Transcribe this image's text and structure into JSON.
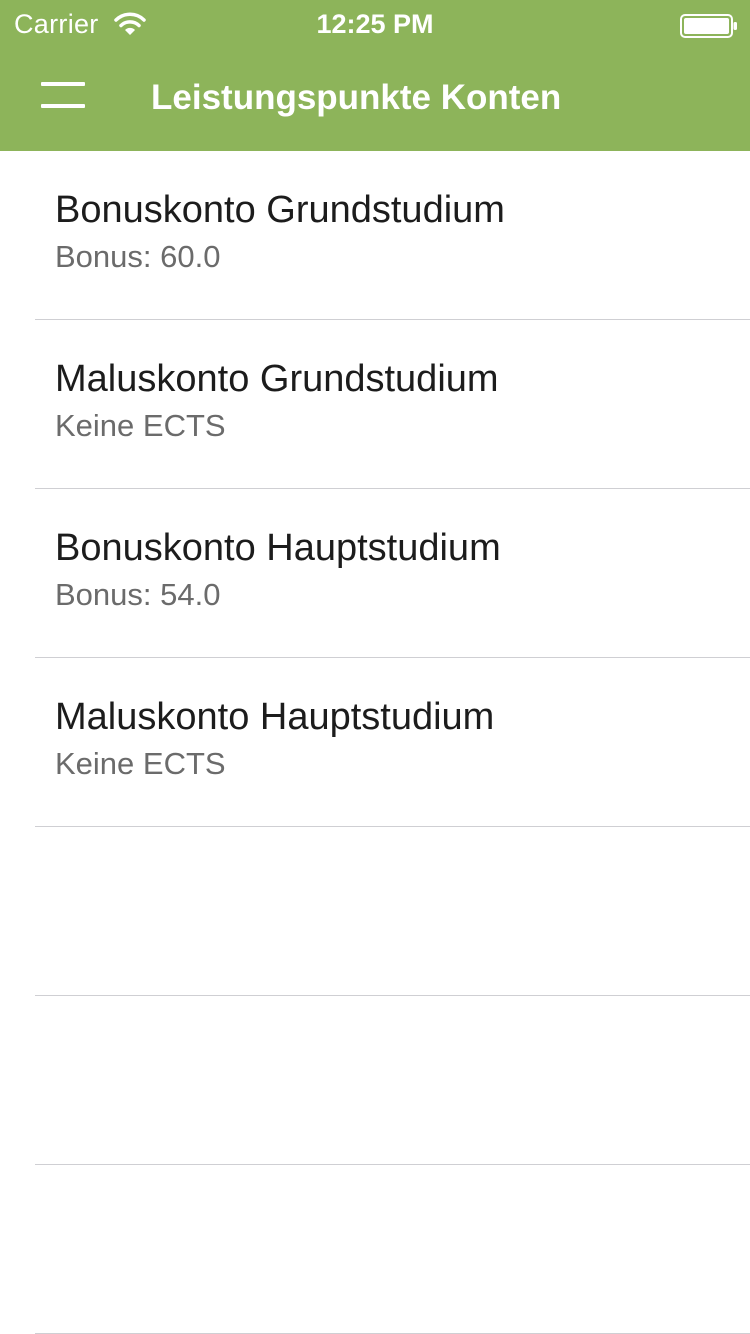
{
  "status_bar": {
    "carrier": "Carrier",
    "time": "12:25 PM",
    "wifi_icon": "wifi-icon",
    "battery_icon": "battery-icon"
  },
  "nav_bar": {
    "menu_icon": "hamburger-menu-icon",
    "title": "Leistungspunkte Konten"
  },
  "colors": {
    "header_background": "#8db45a",
    "header_text": "#ffffff",
    "title_text": "#1c1c1c",
    "subtitle_text": "#6b6b6b",
    "separator": "#cfcfd3"
  },
  "accounts": [
    {
      "title": "Bonuskonto Grundstudium",
      "subtitle": "Bonus: 60.0"
    },
    {
      "title": "Maluskonto Grundstudium",
      "subtitle": "Keine ECTS"
    },
    {
      "title": "Bonuskonto Hauptstudium",
      "subtitle": "Bonus: 54.0"
    },
    {
      "title": "Maluskonto Hauptstudium",
      "subtitle": "Keine ECTS"
    }
  ]
}
